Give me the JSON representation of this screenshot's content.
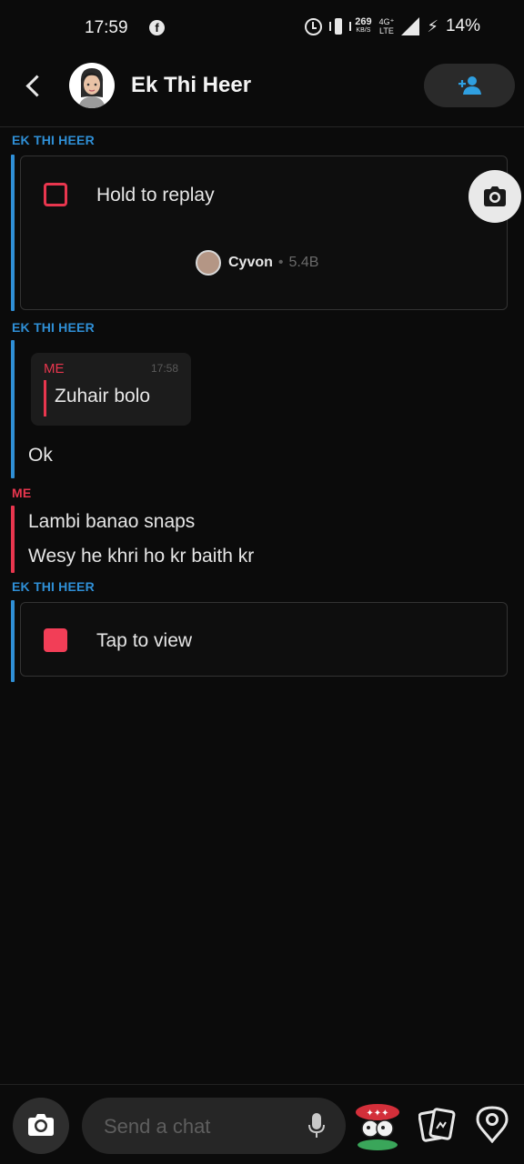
{
  "status_bar": {
    "time": "17:59",
    "net_speed": "269",
    "net_speed_unit": "KB/S",
    "net_type_top": "4G⁺",
    "net_type_bottom": "LTE",
    "battery": "14%"
  },
  "header": {
    "contact_name": "Ek Thi Heer"
  },
  "messages": [
    {
      "sender": "EK THI HEER",
      "snap_label": "Hold to replay",
      "lens_name": "Cyvon",
      "lens_views": "5.4B"
    },
    {
      "sender": "EK THI HEER",
      "quote_sender": "ME",
      "quote_time": "17:58",
      "quote_text": "Zuhair bolo",
      "text": "Ok"
    },
    {
      "sender": "ME",
      "lines": [
        "Lambi banao snaps",
        "Wesy he khri ho kr baith kr"
      ]
    },
    {
      "sender": "EK THI HEER",
      "snap_label": "Tap to view"
    }
  ],
  "composer": {
    "placeholder": "Send a chat"
  },
  "colors": {
    "friend_accent": "#2f8fd6",
    "me_accent": "#e8364e",
    "snap_red": "#f23e57",
    "background": "#0b0b0b"
  },
  "icons": [
    "facebook-icon",
    "alarm-icon",
    "vibrate-icon",
    "signal-icon",
    "charging-icon",
    "back-icon",
    "add-friend-icon",
    "camera-icon",
    "mic-icon",
    "sticker-icon",
    "memories-icon",
    "lens-pin-icon"
  ]
}
